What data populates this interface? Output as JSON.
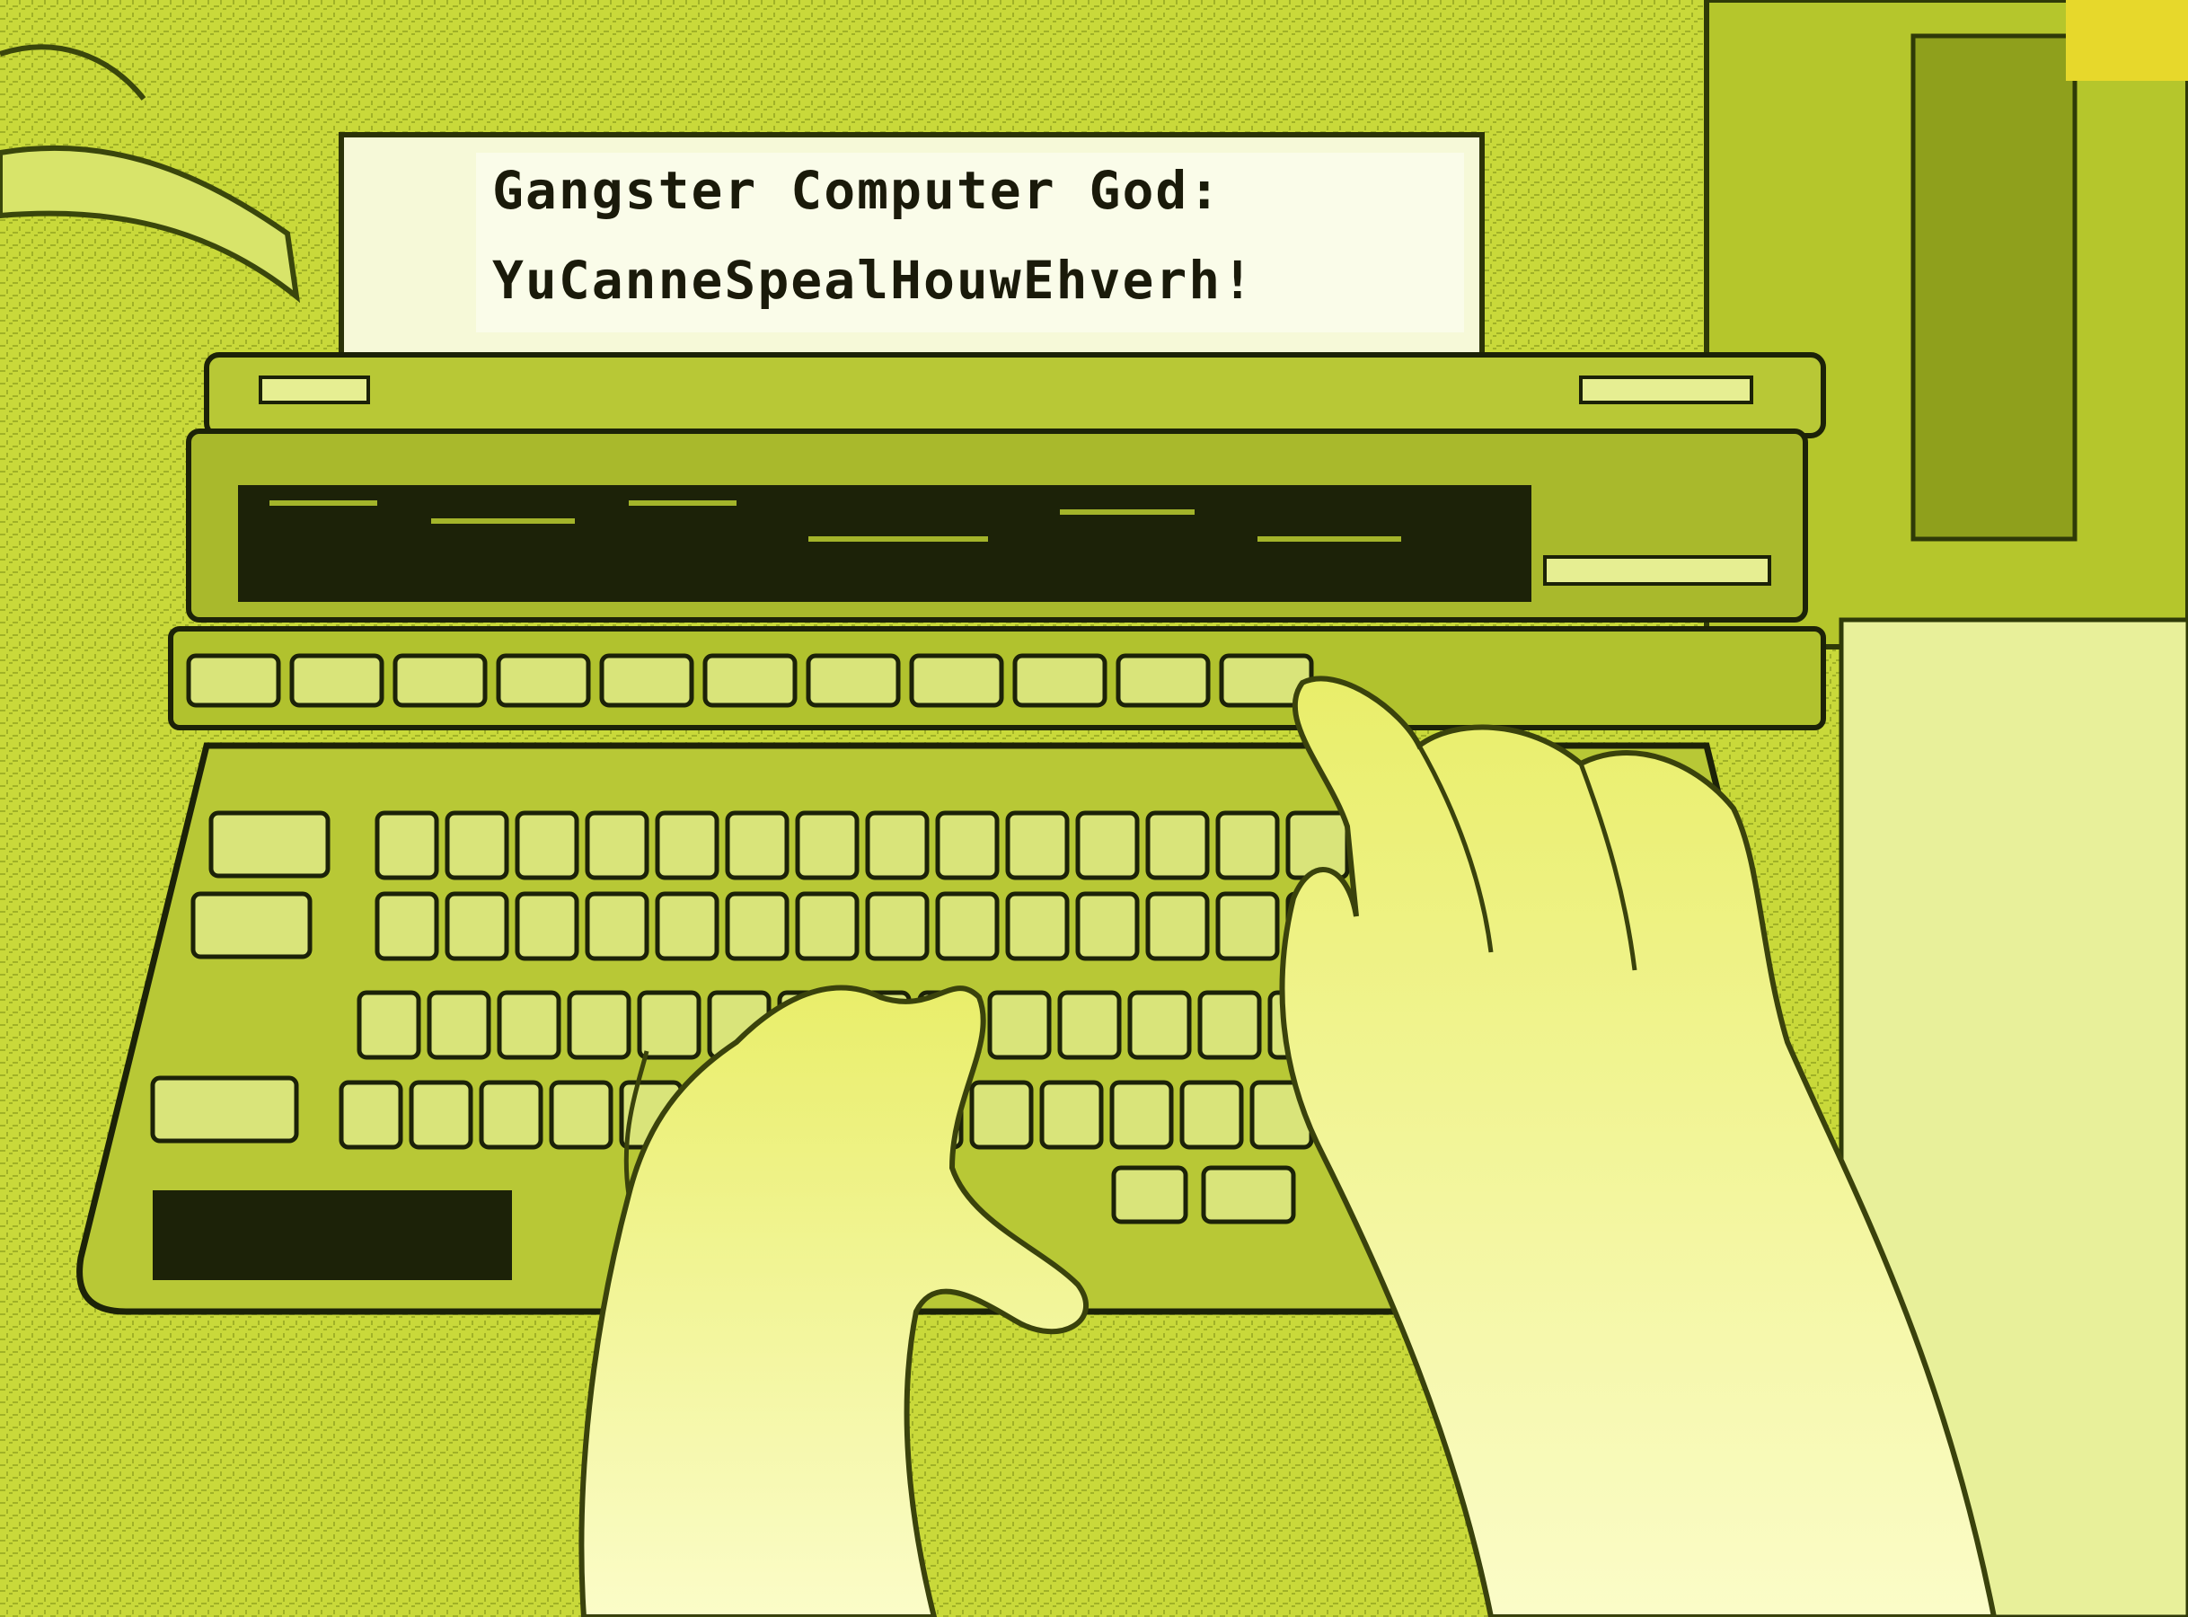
{
  "paper": {
    "line1": "Gangster Computer God:",
    "line2": "YuCanneSpealHouwEhverh!"
  },
  "palette": {
    "background": "#c9d93a",
    "machine_body": "#b8c836",
    "machine_dark": "#1c2208",
    "paper": "#f6f9d8",
    "keys": "#d9e47a",
    "hands": "#f0f27a",
    "ink": "#1a1a0a"
  },
  "icons": {
    "keyboard": "typewriter-keyboard-icon",
    "hands": "typing-hands-icon"
  }
}
